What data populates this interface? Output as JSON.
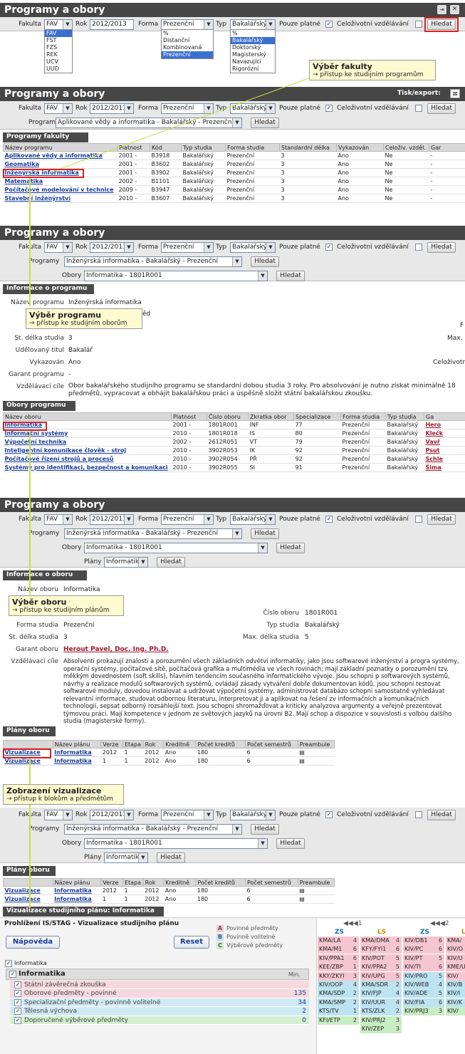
{
  "title": "Programy a obory",
  "filters": {
    "fakulta_label": "Fakulta",
    "fakulta_value": "FAV",
    "rok_label": "Rok",
    "rok_value": "2012/2013",
    "forma_label": "Forma",
    "forma_value": "Prezenční",
    "typ_label": "Typ",
    "typ_value": "Bakalářský",
    "pouze_label": "Pouze platné",
    "celoziv_label": "Celoživotní vzdělávání",
    "search_label": "Hledat",
    "programy_label": "Programy",
    "obory_label": "Obory",
    "plany_label": "Plány"
  },
  "fakulty_options": [
    "FAV",
    "FST",
    "FZS",
    "REK",
    "UCV",
    "UUD"
  ],
  "forma_options": [
    "%",
    "Distanční",
    "Kombinovaná",
    "Prezenční"
  ],
  "typ_options": [
    "%",
    "Bakalářský",
    "Doktorský",
    "Magisterský",
    "Navazující",
    "Rigorózní"
  ],
  "export_label": "Tisk/export:",
  "program_value_1": "Aplikované vědy a informatika - Bakalářský - Prezenční",
  "program_value_2": "Inženýrská informatika - Bakalářský - Prezenční",
  "obor_value": "Informatika - 1801R001",
  "plan_value": "Informatika",
  "callouts": {
    "c1_title": "Výběr fakulty",
    "c1_text": "→ přístup ke studijním programům",
    "c2_title": "Výběr programu",
    "c2_text": "→ přístup ke studijním oborům",
    "c3_title": "Výběr oboru",
    "c3_text": "→ přístup ke studijním plánům",
    "c4_title": "Zobrazení vizualizace",
    "c4_text": "→ přístup k blokům a předmětům"
  },
  "programy_fakulty": {
    "heading": "Programy fakulty",
    "headers": [
      "Název programu",
      "Platnost",
      "Kód",
      "Typ studia",
      "Forma studia",
      "Standardní délka",
      "Vykazován",
      "Celoživ. vzděl.",
      "Gar"
    ],
    "rows": [
      [
        "Aplikované vědy a informatika",
        "2001 -",
        "B3918",
        "Bakalářský",
        "Prezenční",
        "3",
        "Ano",
        "Ne",
        "-"
      ],
      [
        "Geomatika",
        "2001 -",
        "B3602",
        "Bakalářský",
        "Prezenční",
        "3",
        "Ano",
        "Ne",
        "-"
      ],
      [
        "Inženýrská informatika",
        "2001 -",
        "B3902",
        "Bakalářský",
        "Prezenční",
        "3",
        "Ano",
        "Ne",
        "-"
      ],
      [
        "Matematika",
        "2002 -",
        "B1101",
        "Bakalářský",
        "Prezenční",
        "3",
        "Ano",
        "Ne",
        "-"
      ],
      [
        "Počítačové modelování v technice",
        "2009 -",
        "B3947",
        "Bakalářský",
        "Prezenční",
        "3",
        "Ano",
        "Ne",
        "-"
      ],
      [
        "Stavební inženýrství",
        "2010 -",
        "B3607",
        "Bakalářský",
        "Prezenční",
        "3",
        "Ano",
        "Ne",
        "-"
      ]
    ]
  },
  "info_program": {
    "heading": "Informace o programu",
    "nazev_label": "Název programu",
    "nazev": "Inženýrská informatika",
    "fragment": "ěd",
    "delka_label": "St. délka studia",
    "delka": "3",
    "max_label": "Max.",
    "titul_label": "Udělovaný titul",
    "titul": "Bakalář",
    "vykazovan_label": "Vykazován",
    "vykazovan": "Ano",
    "celoziv_label": "Celoživotn",
    "garant_label": "Garant programu",
    "garant": "-",
    "cile_label": "Vzdělávací cíle",
    "cile": "Obor bakalářského studijního programu se standardní dobou studia 3 roky. Pro absolvování je nutno získat minimálně 18 předmětů, vypracovat a obhájit bakalářskou práci a úspěšně složit státní bakalářskou zkoušku.",
    "r_label": "F"
  },
  "obory_programu": {
    "heading": "Obory programu",
    "headers": [
      "Název oboru",
      "Platnost",
      "Číslo oboru",
      "Zkratka obor",
      "Specializace",
      "Forma studia",
      "Typ studia",
      "Ga"
    ],
    "rows": [
      [
        "Informatika",
        "2001 -",
        "1801R001",
        "INF",
        "77",
        "Prezenční",
        "Bakalářský",
        "Hero"
      ],
      [
        "Informační systémy",
        "2010 -",
        "1801R018",
        "IS",
        "80",
        "Prezenční",
        "Bakalářský",
        "Klečk"
      ],
      [
        "Výpočetní technika",
        "2002 -",
        "2612R051",
        "VT",
        "79",
        "Prezenční",
        "Bakalářský",
        "Vavř"
      ],
      [
        "Inteligentní komunikace člověk - stroj",
        "2010 -",
        "3902R053",
        "IK",
        "92",
        "Prezenční",
        "Bakalářský",
        "Psut"
      ],
      [
        "Počítačové řízení strojů a procesů",
        "2010 -",
        "3902R054",
        "PŘ",
        "92",
        "Prezenční",
        "Bakalářský",
        "Schle"
      ],
      [
        "Systémy pro identifikaci, bezpečnost a komunikaci",
        "2010 -",
        "3902R055",
        "SI",
        "91",
        "Prezenční",
        "Bakalářský",
        "Šima"
      ]
    ]
  },
  "info_obor": {
    "heading": "Informace o oboru",
    "nazev_label": "Název oboru",
    "nazev": "Informatika",
    "cislo_label": "Číslo oboru",
    "cislo": "1801R001",
    "forma_label": "Forma studia",
    "forma": "Prezenční",
    "typ_label": "Typ studia",
    "typ": "Bakalářský",
    "delka_label": "St. délka studia",
    "delka": "3",
    "max_label": "Max. délka studia",
    "max": "5",
    "garant_label": "Garant oboru",
    "garant": "Herout Pavel, Doc. Ing. Ph.D.",
    "cile_label": "Vzdělávací cíle",
    "cile": "Absolventi prokazují znalosti a porozumění všech základních odvětví informatiky, jako jsou softwarové inženýrství a progra systémy, operační systémy, počítačové sítě, počítačová grafika a multimédia ve všech rovinách; mají základní poznatky o porozumění tzv. měkkým dovednostem (soft skills), hlavním tendencím současného informatického vývoje. Jsou schopni p softwarových systémů, návrhy a realizace modulů softwarových systémů, ovládají zásady vytváření dobře dokumentovan kódů, jsou schopni testovat softwarové moduly, dovedou instalovat a udržovat výpočetní systémy, administrovat databázo schopni samostatně vyhledávat relevantní informace, studovat odbornou literaturu, interpretovat ji a aplikovat na řešení zv informačních a komunikačních technologií, sepsat odborný rozsáhlejší text. Jsou schopni shromažďovat a kriticky analyzova argumenty a veřejně prezentovat týmovou práci. Mají kompetence v jednom ze světových jazyků na úrovni B2. Mají schop a dispozice v souvislosti s volbou dalšího studia (magisterské formy)."
  },
  "plany": {
    "heading": "Plány oboru",
    "heading2": "Plány oboru",
    "headers": [
      "",
      "Název plánu",
      "Verze",
      "Etapa",
      "Rok",
      "Kreditně",
      "Počet kreditů",
      "Počet semestrů",
      "Preambule"
    ],
    "rows": [
      [
        "Vizualizace",
        "Informatika",
        "2012",
        "1",
        "2012",
        "Ano",
        "180",
        "6"
      ],
      [
        "Vizualizace",
        "Informatika",
        "1",
        "1",
        "2012",
        "Ano",
        "180",
        "6"
      ]
    ]
  },
  "vis": {
    "heading": "Vizualizace studijního plánu: Informatika",
    "app_title": "Prohlížení IS/STAG - Vizualizace studijního plánu",
    "help_label": "Nápověda",
    "reset_label": "Reset",
    "legend": [
      {
        "k": "A",
        "t": "Povinné předměty",
        "c": "#f6c6d0"
      },
      {
        "k": "B",
        "t": "Povinně volitelné",
        "c": "#bde2f0"
      },
      {
        "k": "C",
        "t": "Výběrové předměty",
        "c": "#c8ecc4"
      }
    ],
    "tree_root": "Informatika",
    "tree_node": "Informatika",
    "min_label": "Min.",
    "blocks": [
      {
        "n": "Státní závěrečná zkouška",
        "v": "",
        "c": "#f6d8de"
      },
      {
        "n": "Oborové předměty - povinné",
        "v": "135",
        "c": "#f6d8de"
      },
      {
        "n": "Specializační předměty - povinně volitelné",
        "v": "34",
        "c": "#d0eaf4"
      },
      {
        "n": "Tělesná výchova",
        "v": "2",
        "c": "#d0eaf4"
      },
      {
        "n": "Doporučené výběrové předměty",
        "v": "0",
        "c": "#d4f0d0"
      }
    ],
    "year1": "◀◀◀1",
    "year2": "◀◀◀2",
    "zs": "ZS",
    "ls": "LS",
    "col1": [
      [
        "KMA/LA",
        "4",
        "#f6c6d0"
      ],
      [
        "KMA/M1",
        "6",
        "#f6c6d0"
      ],
      [
        "KIV/PPA1",
        "6",
        "#f6c6d0"
      ],
      [
        "KEE/ZBP",
        "1",
        "#f6c6d0"
      ],
      [
        "KKY/ZKYI",
        "3",
        "#f6c6d0"
      ],
      [
        "KIV/OOP",
        "4",
        "#bde2f0"
      ],
      [
        "KMA/SDP",
        "2",
        "#bde2f0"
      ],
      [
        "KMA/SMP",
        "2",
        "#bde2f0"
      ],
      [
        "KTS/TV",
        "1",
        "#bde2f0"
      ],
      [
        "KFI/ETP",
        "2",
        "#c8ecc4"
      ]
    ],
    "col2": [
      [
        "KMA/DMA",
        "4",
        "#f6c6d0"
      ],
      [
        "KFY/FYI1",
        "6",
        "#f6c6d0"
      ],
      [
        "KIV/POT",
        "5",
        "#f6c6d0"
      ],
      [
        "KIV/PPA2",
        "5",
        "#f6c6d0"
      ],
      [
        "KIV/UPG",
        "5",
        "#f6c6d0"
      ],
      [
        "KMA/SDR",
        "2",
        "#bde2f0"
      ],
      [
        "KIV/FJP",
        "4",
        "#bde2f0"
      ],
      [
        "KIV/UUR",
        "4",
        "#bde2f0"
      ],
      [
        "KTS/ZLK",
        "2",
        "#bde2f0"
      ],
      [
        "KIV/PRJ2",
        "3",
        "#c8ecc4"
      ],
      [
        "KIV/ZEP",
        "3",
        "#c8ecc4"
      ]
    ],
    "col3": [
      [
        "KIV/DB1",
        "6",
        "#f6c6d0"
      ],
      [
        "KIV/PC",
        "6",
        "#f6c6d0"
      ],
      [
        "KIV/PT",
        "5",
        "#f6c6d0"
      ],
      [
        "KIV/TI",
        "6",
        "#f6c6d0"
      ],
      [
        "KIV/PRO",
        "5",
        "#bde2f0"
      ],
      [
        "KIV/WEB",
        "4",
        "#bde2f0"
      ],
      [
        "KIV/ADE",
        "5",
        "#bde2f0"
      ],
      [
        "KIV/FIA",
        "6",
        "#bde2f0"
      ],
      [
        "KIV/PRJ3",
        "3",
        "#c8ecc4"
      ]
    ],
    "col4": [
      [
        "KMA/",
        "",
        "#f6c6d0"
      ],
      [
        "KIV/O",
        "",
        "#f6c6d0"
      ],
      [
        "KIV/U",
        "",
        "#f6c6d0"
      ],
      [
        "KME/U",
        "",
        "#f6c6d0"
      ],
      [
        "KIV/",
        "",
        "#f6c6d0"
      ],
      [
        "KIV/B",
        "",
        "#bde2f0"
      ],
      [
        "KIV/I",
        "",
        "#bde2f0"
      ],
      [
        "KIV/K",
        "",
        "#bde2f0"
      ],
      [
        "KIV/",
        "",
        "#c8ecc4"
      ]
    ]
  }
}
